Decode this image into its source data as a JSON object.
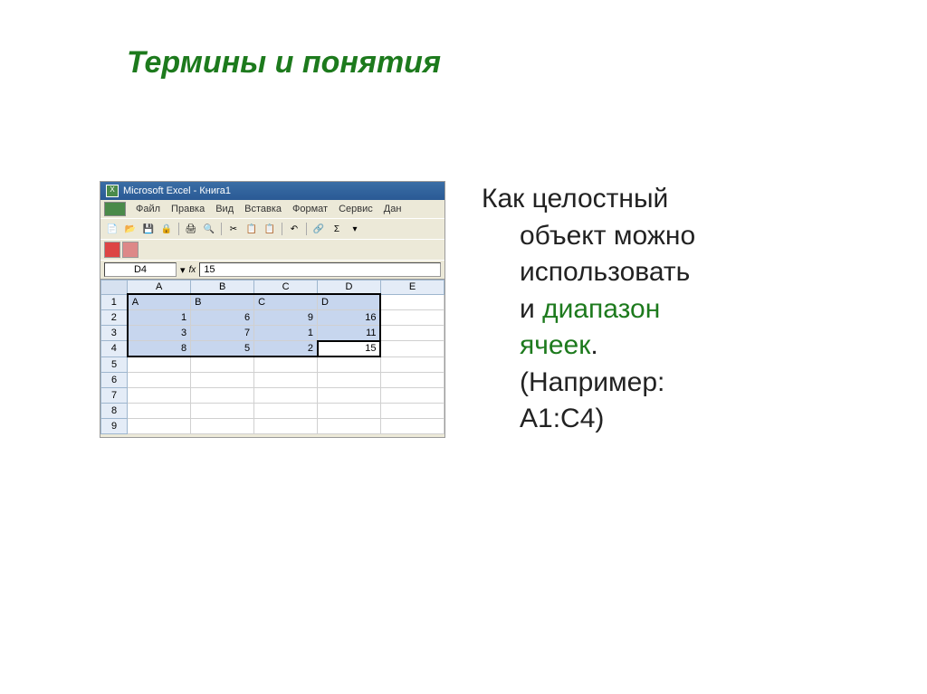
{
  "title": "Термины и понятия",
  "body": {
    "line1": "Как целостный",
    "line2": "объект можно",
    "line3": "использовать",
    "line4a": "и ",
    "line4b": "диапазон",
    "line5": "ячеек",
    "line5dot": ".",
    "line6": "(Например:",
    "line7": "A1:C4)"
  },
  "excel": {
    "titlebar": "Microsoft Excel - Книга1",
    "menu": {
      "file": "Файл",
      "edit": "Правка",
      "view": "Вид",
      "insert": "Вставка",
      "format": "Формат",
      "tools": "Сервис",
      "data": "Дан"
    },
    "name_box": "D4",
    "formula_value": "15",
    "fx_label": "fx",
    "columns": [
      "A",
      "B",
      "C",
      "D",
      "E"
    ],
    "rows": [
      {
        "n": "1",
        "cells": [
          "A",
          "B",
          "C",
          "D",
          ""
        ]
      },
      {
        "n": "2",
        "cells": [
          "1",
          "6",
          "9",
          "16",
          ""
        ]
      },
      {
        "n": "3",
        "cells": [
          "3",
          "7",
          "1",
          "11",
          ""
        ]
      },
      {
        "n": "4",
        "cells": [
          "8",
          "5",
          "2",
          "15",
          ""
        ]
      },
      {
        "n": "5",
        "cells": [
          "",
          "",
          "",
          "",
          ""
        ]
      },
      {
        "n": "6",
        "cells": [
          "",
          "",
          "",
          "",
          ""
        ]
      },
      {
        "n": "7",
        "cells": [
          "",
          "",
          "",
          "",
          ""
        ]
      },
      {
        "n": "8",
        "cells": [
          "",
          "",
          "",
          "",
          ""
        ]
      },
      {
        "n": "9",
        "cells": [
          "",
          "",
          "",
          "",
          ""
        ]
      }
    ]
  }
}
